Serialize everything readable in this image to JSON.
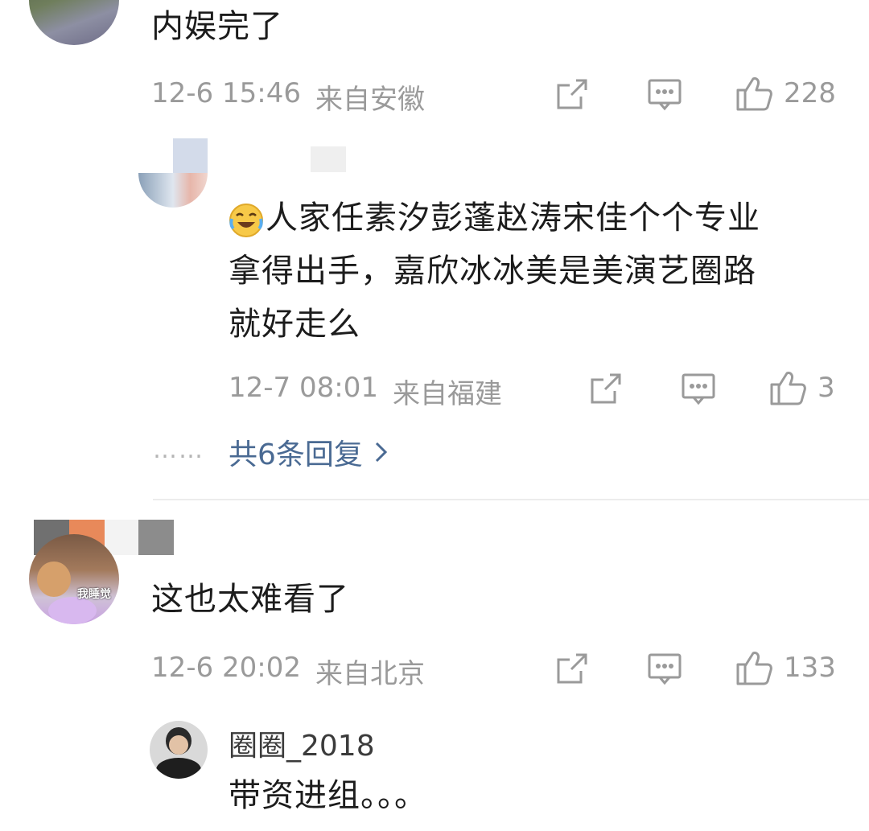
{
  "comments": [
    {
      "text": "内娱完了",
      "time": "12-6 15:46",
      "location": "来自安徽",
      "likes": "228",
      "reply": {
        "text_line1": "人家任素汐彭蓬赵涛宋佳个个专业",
        "text_line2": "拿得出手，嘉欣冰冰美是美演艺圈路",
        "text_line3": "就好走么",
        "emoji": "laughing-crying-emoji",
        "time": "12-7 08:01",
        "location": "来自福建",
        "likes": "3"
      },
      "more_replies": "共6条回复",
      "more_dots": "……"
    },
    {
      "text": "这也太难看了",
      "avatar_badge": "我睡觉",
      "time": "12-6 20:02",
      "location": "来自北京",
      "likes": "133",
      "reply": {
        "username": "圈圈_2018",
        "text": "带资进组。。。"
      }
    }
  ],
  "icons": {
    "share": "share-icon",
    "comment": "comment-icon",
    "like": "thumbs-up-icon",
    "chevron": "chevron-right-icon"
  },
  "colors": {
    "link": "#4a6a93",
    "meta": "#9a9a9a"
  }
}
